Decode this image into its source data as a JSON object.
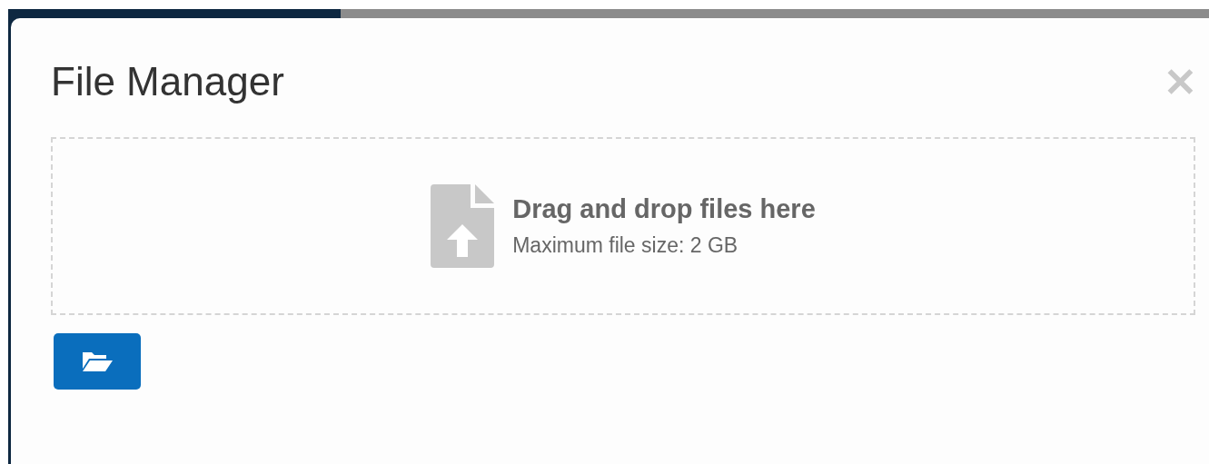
{
  "dialog": {
    "title": "File Manager",
    "close": "✕",
    "dropzone": {
      "title": "Drag and drop files here",
      "subtitle": "Maximum file size: 2 GB"
    }
  }
}
